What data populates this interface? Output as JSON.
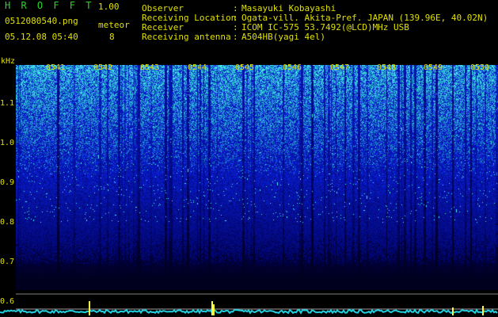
{
  "header": {
    "app_title": "H R O F F T",
    "app_version": "1.00",
    "file_name": "0512080540.png",
    "datetime": "05.12.08 05:40",
    "meteor_label": "meteor",
    "meteor_count": "8"
  },
  "station_info": [
    {
      "label": "Observer",
      "value": "Masayuki Kobayashi"
    },
    {
      "label": "Receiving Location",
      "value": "Ogata-vill. Akita-Pref. JAPAN (139.96E, 40.02N)"
    },
    {
      "label": "Receiver",
      "value": "ICOM IC-575 53.7492(@LCD)MHz USB"
    },
    {
      "label": "Receiving antenna",
      "value": "A504HB(yagi 4el)"
    }
  ],
  "separator": ":",
  "y_axis": {
    "unit": "kHz",
    "ticks": [
      {
        "label": "1.1",
        "value": 1.1
      },
      {
        "label": "1.0",
        "value": 1.0
      },
      {
        "label": "0.9",
        "value": 0.9
      },
      {
        "label": "0.8",
        "value": 0.8
      },
      {
        "label": "0.7",
        "value": 0.7
      },
      {
        "label": "0.6",
        "value": 0.6
      }
    ]
  },
  "time_axis": [
    "0541",
    "0542",
    "0543",
    "0544",
    "0545",
    "0546",
    "0547",
    "0548",
    "0549",
    "0550"
  ],
  "colors": {
    "background": "#000000",
    "text": "#e0e000",
    "title": "#2bd62b",
    "noise_low": "#0b1a8a",
    "noise_high": "#3fe0d0",
    "baseline": "#20d0e0",
    "meteor_spike": "#ffff40"
  }
}
